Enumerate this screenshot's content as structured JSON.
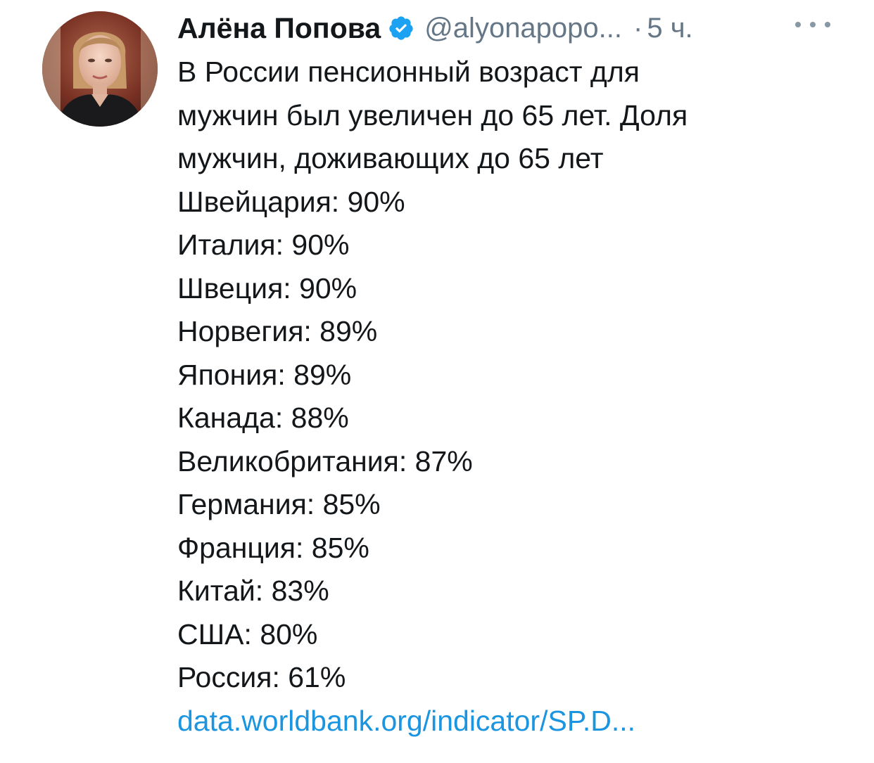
{
  "tweet": {
    "author_name": "Алёна Попова",
    "handle": "@alyonapopo...",
    "separator": "·",
    "time": "5 ч.",
    "verified_icon": "verified-badge-icon",
    "more_icon": "more-options-icon",
    "accent_color": "#1b95e0",
    "text_lines": [
      "В России пенсионный возраст для",
      "мужчин был увеличен до 65 лет. Доля",
      "мужчин, доживающих до 65 лет"
    ],
    "countries": [
      "Швейцария: 90%",
      "Италия: 90%",
      "Швеция: 90%",
      "Норвегия: 89%",
      "Япония: 89%",
      "Канада: 88%",
      "Великобритания: 87%",
      "Германия: 85%",
      "Франция: 85%",
      "Китай: 83%",
      "США: 80%",
      "Россия: 61%"
    ],
    "link": "data.worldbank.org/indicator/SP.D..."
  }
}
